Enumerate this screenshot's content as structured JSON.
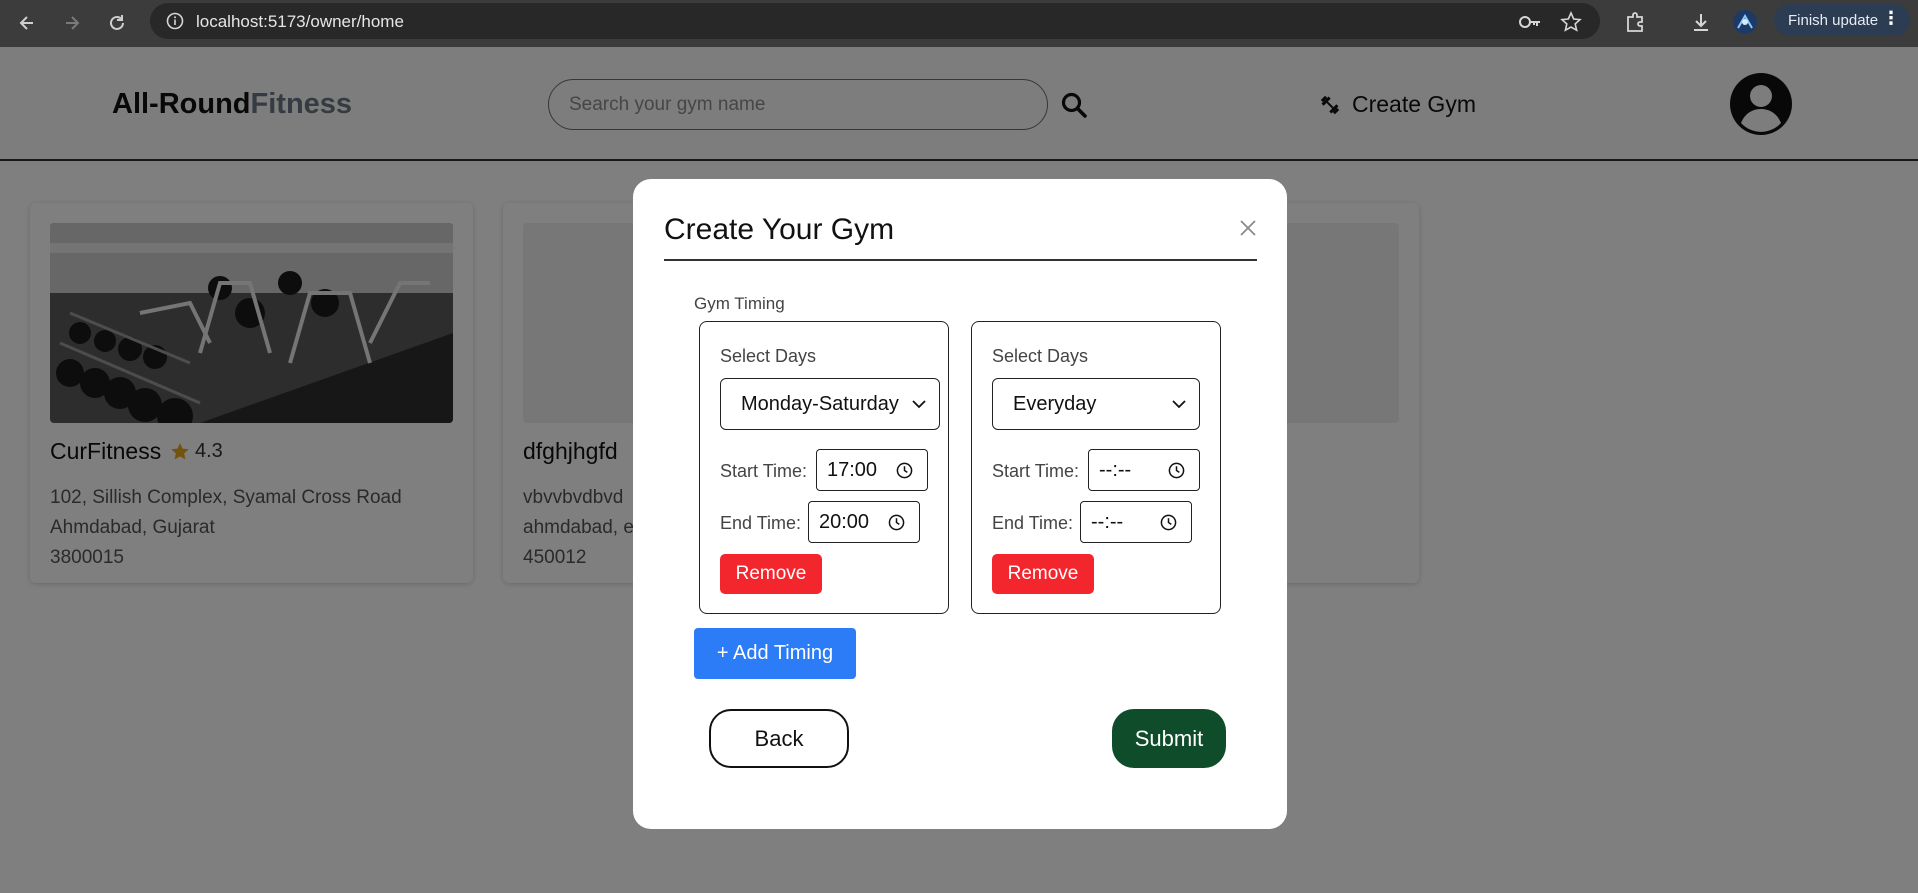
{
  "browser": {
    "url": "localhost:5173/owner/home",
    "finish_update_label": "Finish update"
  },
  "header": {
    "logo_part1": "All-Round",
    "logo_part2": "Fitness",
    "search_placeholder": "Search your gym name",
    "create_gym_label": "Create Gym"
  },
  "cards": [
    {
      "name": "CurFitness",
      "rating": "4.3",
      "address_line1": "102, Sillish Complex, Syamal Cross Road",
      "address_line2": "Ahmdabad, Gujarat",
      "address_line3": "3800015"
    },
    {
      "name": "dfghjhgfd",
      "address_line1": "vbvvbvdbvd",
      "address_line2": "ahmdabad, e",
      "address_line3": "450012"
    }
  ],
  "modal": {
    "title": "Create Your Gym",
    "timing_label": "Gym Timing",
    "timings": [
      {
        "select_days_label": "Select Days",
        "days_value": "Monday-Saturday",
        "start_label": "Start Time:",
        "start_value": "17:00",
        "end_label": "End Time:",
        "end_value": "20:00",
        "remove_label": "Remove"
      },
      {
        "select_days_label": "Select Days",
        "days_value": "Everyday",
        "start_label": "Start Time:",
        "start_value": "--:--",
        "end_label": "End Time:",
        "end_value": "--:--",
        "remove_label": "Remove"
      }
    ],
    "add_timing_label": "+ Add Timing",
    "back_label": "Back",
    "submit_label": "Submit"
  },
  "colors": {
    "remove_red": "#f3262d",
    "add_blue": "#2b7cf6",
    "submit_green": "#0f4c2a",
    "star_gold": "#e5a91d"
  }
}
